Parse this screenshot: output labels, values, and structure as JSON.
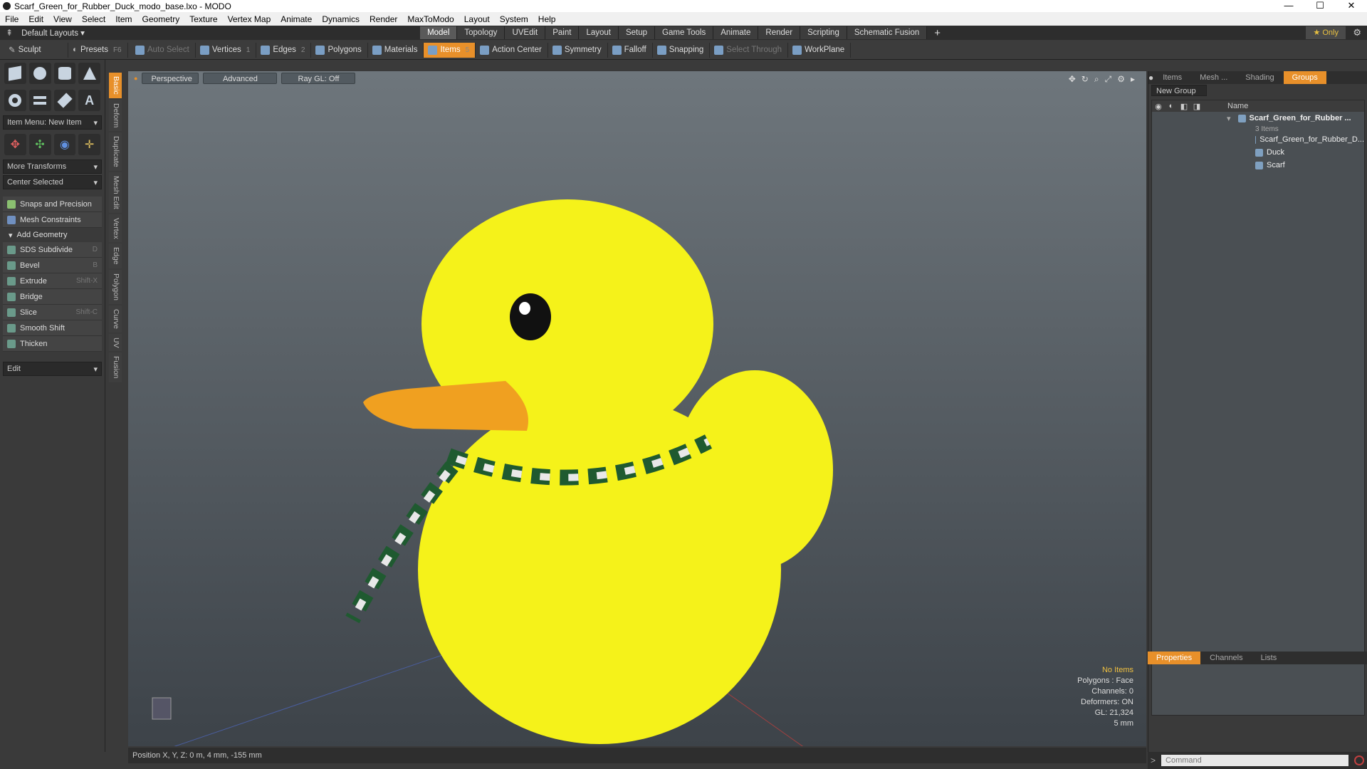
{
  "window": {
    "title": "Scarf_Green_for_Rubber_Duck_modo_base.lxo - MODO",
    "min": "—",
    "max": "☐",
    "close": "✕"
  },
  "menu": [
    "File",
    "Edit",
    "View",
    "Select",
    "Item",
    "Geometry",
    "Texture",
    "Vertex Map",
    "Animate",
    "Dynamics",
    "Render",
    "MaxToModo",
    "Layout",
    "System",
    "Help"
  ],
  "layoutbar": {
    "default_layouts": "Default Layouts ▾",
    "tabs": [
      "Model",
      "Topology",
      "UVEdit",
      "Paint",
      "Layout",
      "Setup",
      "Game Tools",
      "Animate",
      "Render",
      "Scripting",
      "Schematic Fusion"
    ],
    "active_tab": "Model",
    "add": "+",
    "only": "★  Only"
  },
  "toolbar": {
    "sculpt": "Sculpt",
    "presets": "Presets",
    "presets_key": "F6",
    "items": [
      {
        "label": "Auto Select",
        "key": "",
        "state": "dim"
      },
      {
        "label": "Vertices",
        "key": "1",
        "state": ""
      },
      {
        "label": "Edges",
        "key": "2",
        "state": ""
      },
      {
        "label": "Polygons",
        "key": "",
        "state": ""
      },
      {
        "label": "Materials",
        "key": "",
        "state": ""
      },
      {
        "label": "Items",
        "key": "5",
        "state": "active"
      },
      {
        "label": "Action Center",
        "key": "",
        "state": ""
      },
      {
        "label": "Symmetry",
        "key": "",
        "state": ""
      },
      {
        "label": "Falloff",
        "key": "",
        "state": ""
      },
      {
        "label": "Snapping",
        "key": "",
        "state": ""
      },
      {
        "label": "Select Through",
        "key": "",
        "state": "dim"
      },
      {
        "label": "WorkPlane",
        "key": "",
        "state": ""
      }
    ]
  },
  "leftpanel": {
    "item_menu": "Item Menu: New Item",
    "more_transforms": "More Transforms",
    "center_selected": "Center Selected",
    "snaps": "Snaps and Precision",
    "mesh_constraints": "Mesh Constraints",
    "add_geometry": "Add Geometry",
    "tools": [
      {
        "label": "SDS Subdivide",
        "key": "D"
      },
      {
        "label": "Bevel",
        "key": "B"
      },
      {
        "label": "Extrude",
        "key": "Shift-X"
      },
      {
        "label": "Bridge",
        "key": ""
      },
      {
        "label": "Slice",
        "key": "Shift-C"
      },
      {
        "label": "Smooth Shift",
        "key": ""
      },
      {
        "label": "Thicken",
        "key": ""
      }
    ],
    "edit": "Edit"
  },
  "sidetabs": [
    "Basic",
    "Deform",
    "Duplicate",
    "Mesh Edit",
    "Vertex",
    "Edge",
    "Polygon",
    "Curve",
    "UV",
    "Fusion"
  ],
  "viewport": {
    "perspective": "Perspective",
    "advanced": "Advanced",
    "raygl": "Ray GL: Off",
    "info": {
      "no_items": "No Items",
      "polygons": "Polygons : Face",
      "channels": "Channels: 0",
      "deformers": "Deformers: ON",
      "gl": "GL: 21,324",
      "scale": "5 mm"
    },
    "colors": {
      "duck": "#f5f21a",
      "beak": "#f0a020",
      "scarf_green": "#1f5a30",
      "scarf_white": "#e8e8e8"
    }
  },
  "statusbar": {
    "position": "Position X, Y, Z:  0 m, 4 mm, -155 mm"
  },
  "rightpanel": {
    "tabs": [
      "Items",
      "Mesh ...",
      "Shading",
      "Groups"
    ],
    "active_tab": "Groups",
    "new_group": "New Group",
    "name_col": "Name",
    "group_name": "Scarf_Green_for_Rubber ...",
    "group_count": "3 Items",
    "children": [
      "Scarf_Green_for_Rubber_D...",
      "Duck",
      "Scarf"
    ],
    "bottom_tabs": [
      "Properties",
      "Channels",
      "Lists"
    ],
    "bottom_active": "Properties",
    "command_placeholder": "Command",
    "cmd_arrow": ">"
  }
}
